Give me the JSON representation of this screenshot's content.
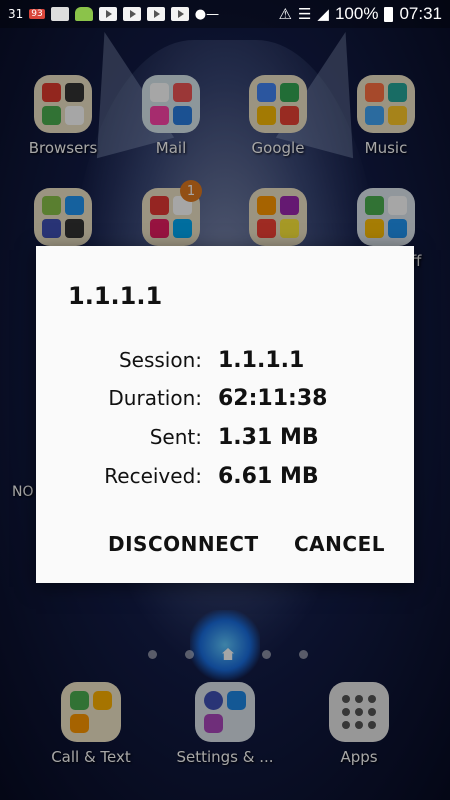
{
  "status_bar": {
    "date_badge": "31",
    "notification_count": "93",
    "battery": "100%",
    "time": "07:31"
  },
  "apps": [
    {
      "label": "Browsers"
    },
    {
      "label": "Mail"
    },
    {
      "label": "Google"
    },
    {
      "label": "Music"
    },
    {
      "label": ""
    },
    {
      "label": "",
      "badge": "1"
    },
    {
      "label": ""
    },
    {
      "label": ""
    }
  ],
  "partial_labels": {
    "right": "ff",
    "left": "NO"
  },
  "dock": [
    {
      "label": "Call & Text"
    },
    {
      "label": "Settings & ..."
    },
    {
      "label": "Apps"
    }
  ],
  "dialog": {
    "title": "1.1.1.1",
    "rows": [
      {
        "label": "Session:",
        "value": "1.1.1.1"
      },
      {
        "label": "Duration:",
        "value": "62:11:38"
      },
      {
        "label": "Sent:",
        "value": "1.31 MB"
      },
      {
        "label": "Received:",
        "value": "6.61 MB"
      }
    ],
    "disconnect_label": "DISCONNECT",
    "cancel_label": "CANCEL"
  }
}
